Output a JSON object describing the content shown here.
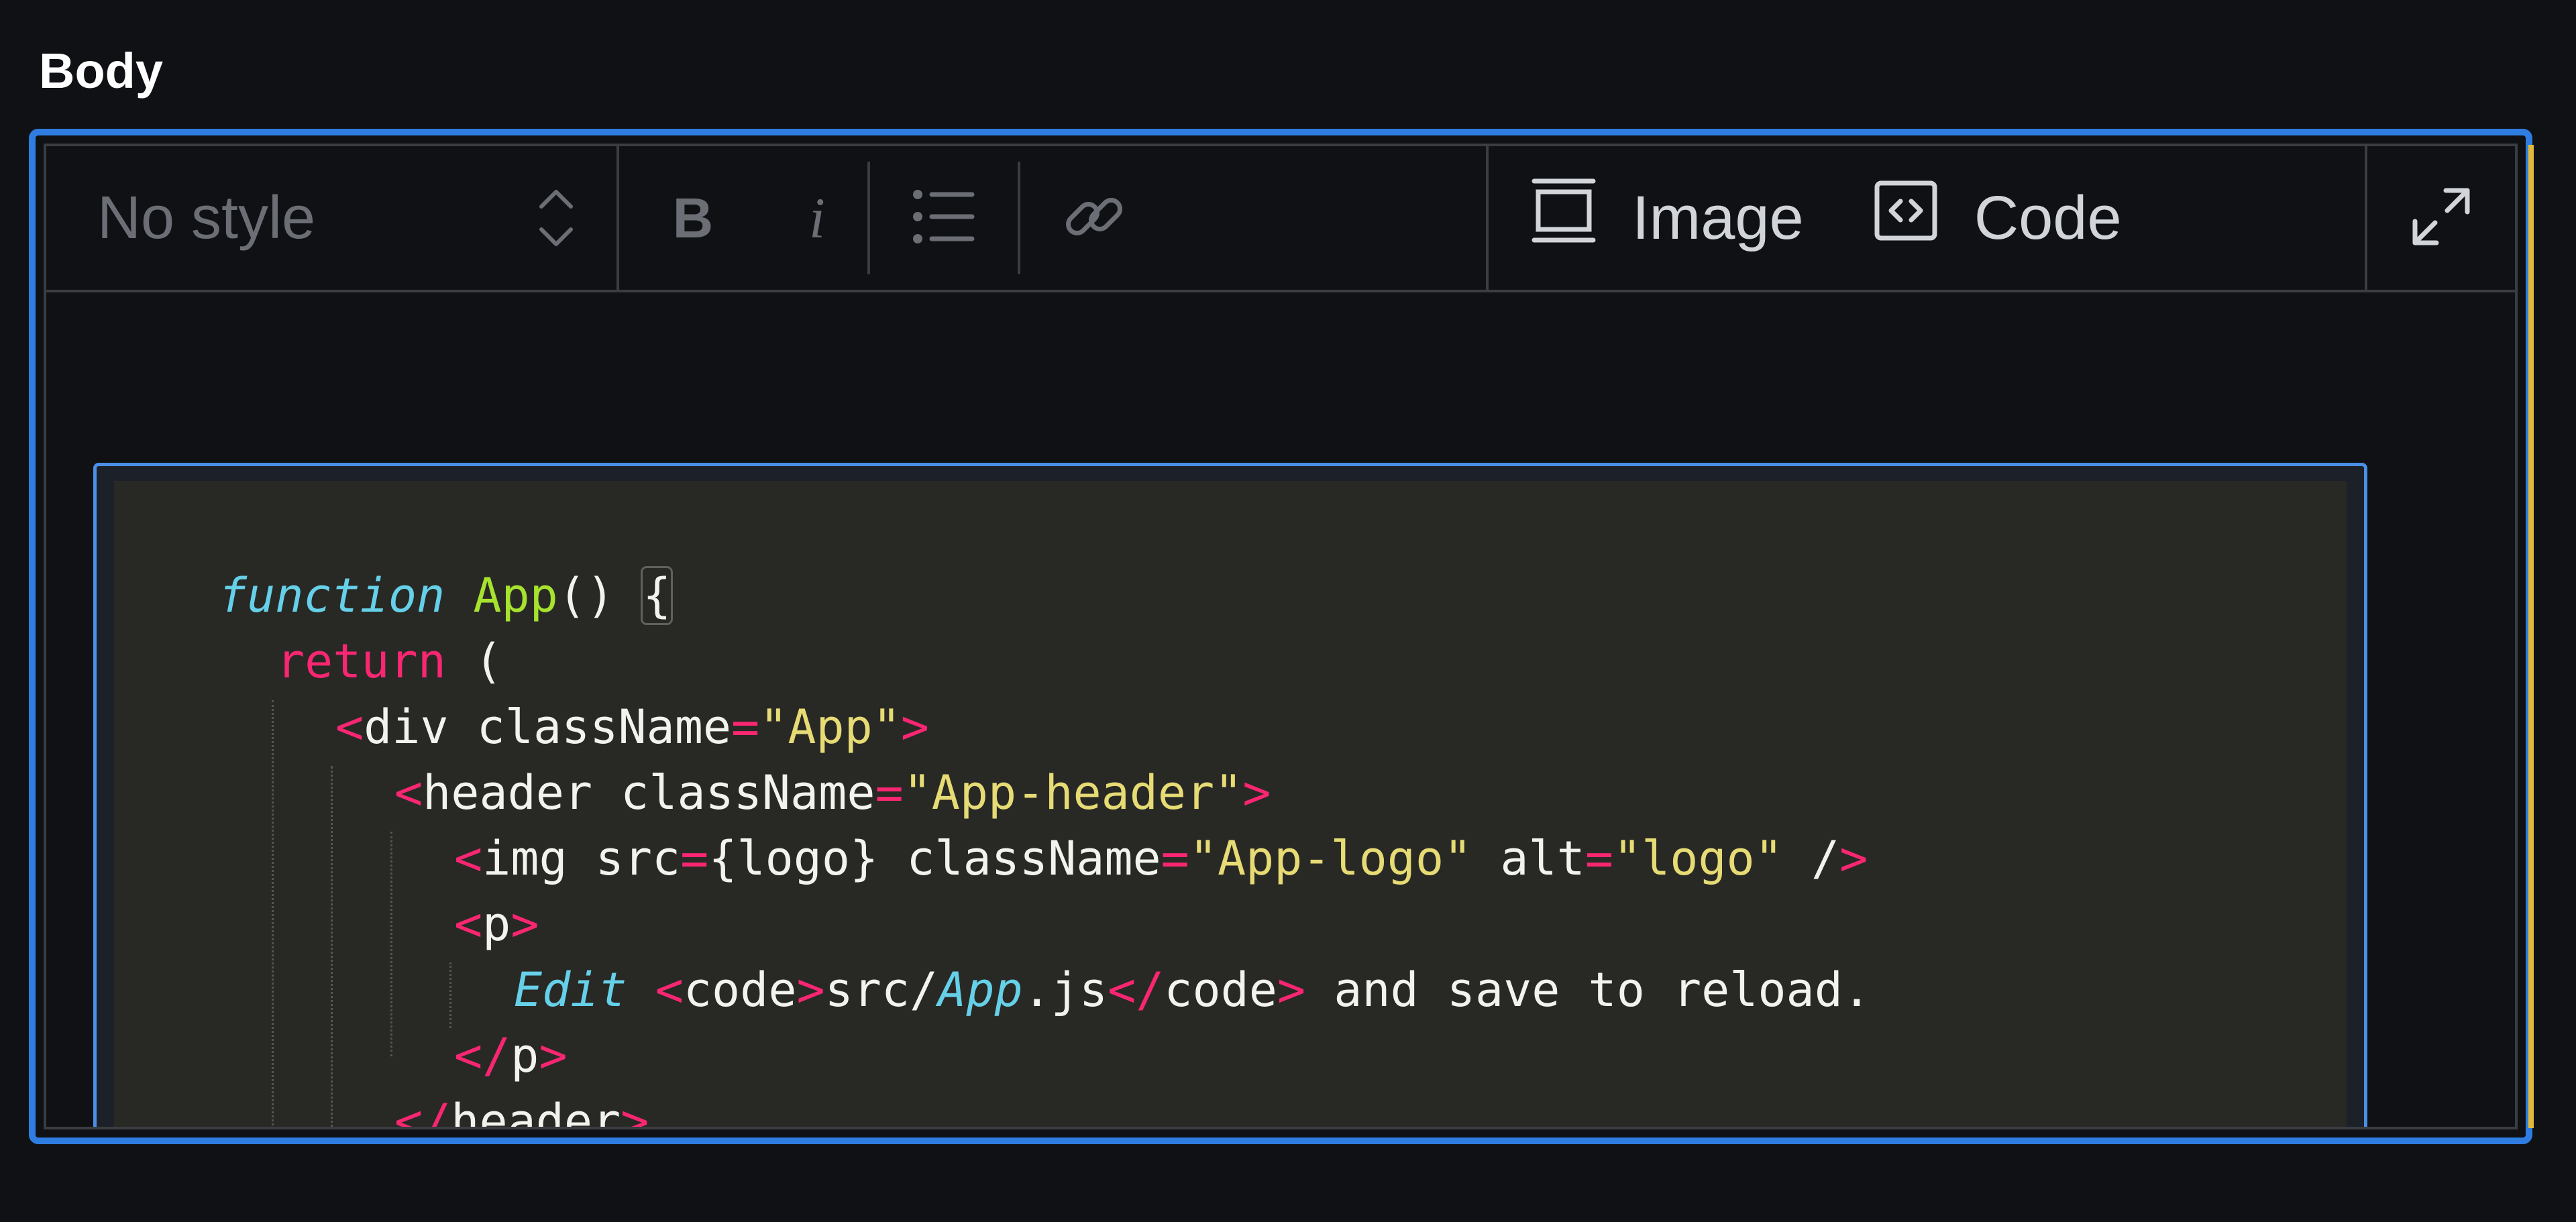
{
  "field": {
    "label": "Body"
  },
  "toolbar": {
    "style_select": {
      "value": "No style"
    },
    "bold_label": "B",
    "italic_label": "i",
    "image_label": "Image",
    "code_label": "Code"
  },
  "colors": {
    "focus_border": "#2f7de1",
    "accent": "#e0b93a",
    "code_bg": "#282925"
  },
  "icons": {
    "style_select": "chevron-up-down-icon",
    "list": "bulleted-list-icon",
    "link": "link-icon",
    "image": "image-icon",
    "code": "code-icon",
    "expand": "expand-icon"
  },
  "code": {
    "line1": {
      "kw": "function",
      "name": "App",
      "rest": "() ",
      "brace": "{"
    },
    "line2": {
      "kw": "return",
      "rest": " ("
    },
    "line3": {
      "open": "<",
      "tag": "div",
      "attr": " className",
      "eq": "=",
      "val": "\"App\"",
      "close": ">"
    },
    "line4": {
      "open": "<",
      "tag": "header",
      "attr": " className",
      "eq": "=",
      "val": "\"App-header\"",
      "close": ">"
    },
    "line5": {
      "open": "<",
      "tag": "img",
      "attr1": " src",
      "eq1": "=",
      "expr": "{logo}",
      "attr2": " className",
      "eq2": "=",
      "val2": "\"App-logo\"",
      "attr3": " alt",
      "eq3": "=",
      "val3": "\"logo\"",
      "slash": " /",
      "close": ">"
    },
    "line6": {
      "open": "<",
      "tag": "p",
      "close": ">"
    },
    "line7": {
      "em": "Edit",
      "sp": " ",
      "open": "<",
      "tag": "code",
      "close": ">",
      "path1": "src/",
      "path_em": "App",
      "path2": ".js",
      "open2": "</",
      "tag2": "code",
      "close2": ">",
      "rest": " and save to reload."
    },
    "line8": {
      "open": "</",
      "tag": "p",
      "close": ">"
    },
    "line9": {
      "open": "</",
      "tag": "header",
      "close": ">"
    }
  }
}
